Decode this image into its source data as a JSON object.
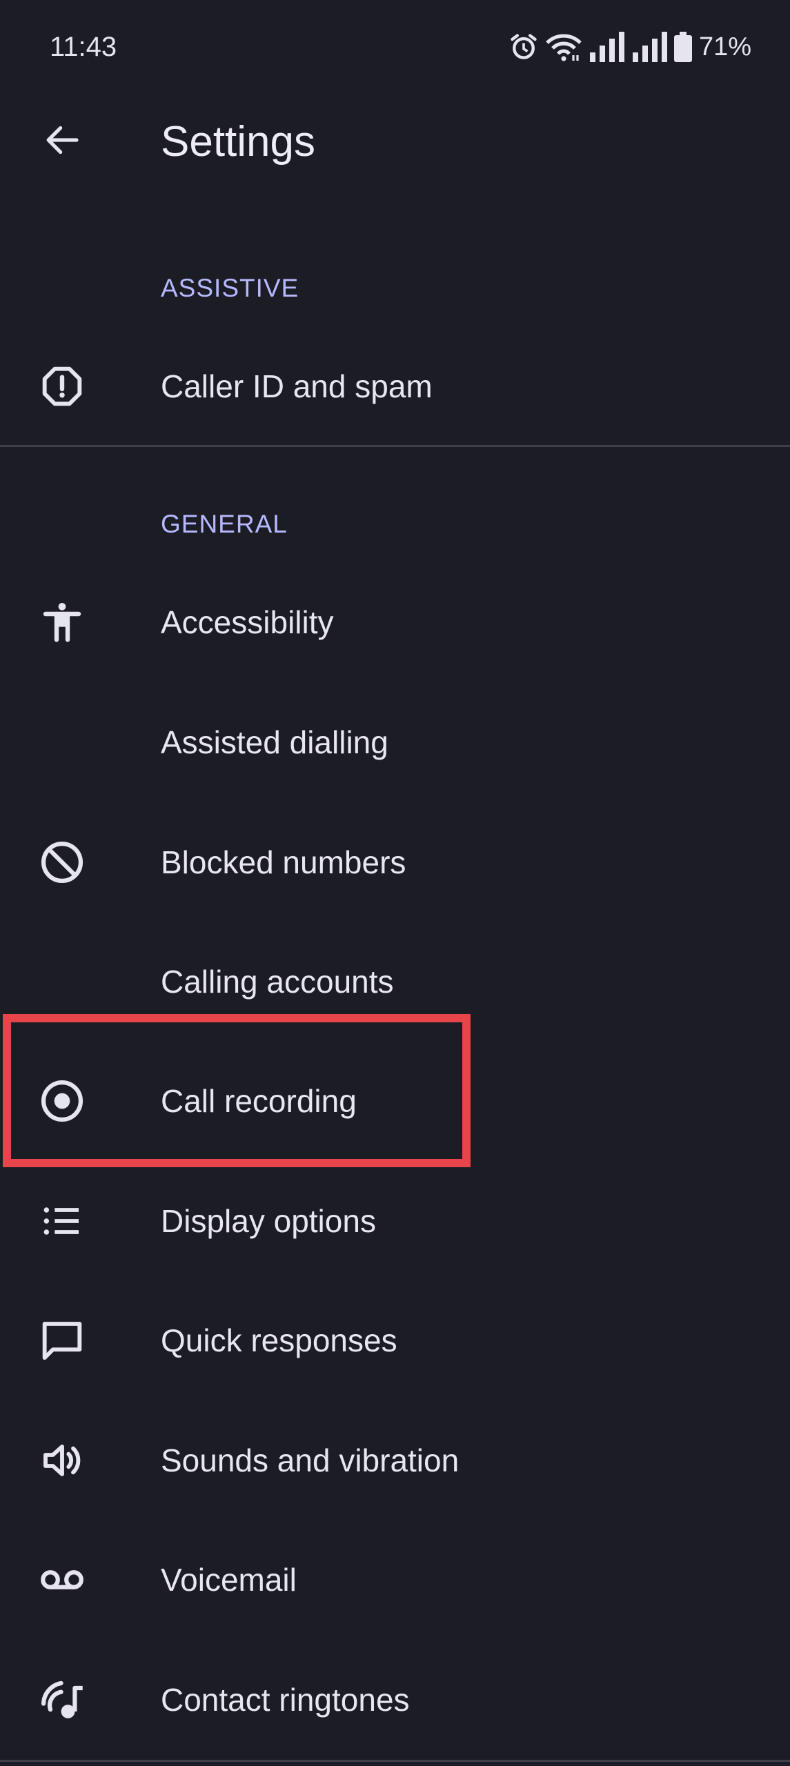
{
  "status_bar": {
    "time": "11:43",
    "battery_percent": "71%",
    "icons": [
      "alarm-icon",
      "wifi-icon",
      "signal-icon",
      "signal-icon",
      "battery-icon"
    ]
  },
  "app_bar": {
    "title": "Settings",
    "back_icon": "arrow-back-icon"
  },
  "sections": {
    "assistive": {
      "header": "ASSISTIVE",
      "items": [
        {
          "label": "Caller ID and spam",
          "icon": "report-octagon-icon"
        }
      ]
    },
    "general": {
      "header": "GENERAL",
      "items": [
        {
          "label": "Accessibility",
          "icon": "accessibility-icon"
        },
        {
          "label": "Assisted dialling",
          "icon": ""
        },
        {
          "label": "Blocked numbers",
          "icon": "block-icon"
        },
        {
          "label": "Calling accounts",
          "icon": ""
        },
        {
          "label": "Call recording",
          "icon": "record-icon"
        },
        {
          "label": "Display options",
          "icon": "list-icon"
        },
        {
          "label": "Quick responses",
          "icon": "chat-bubble-icon"
        },
        {
          "label": "Sounds and vibration",
          "icon": "volume-icon"
        },
        {
          "label": "Voicemail",
          "icon": "voicemail-icon"
        },
        {
          "label": "Contact ringtones",
          "icon": "ringtone-icon"
        }
      ]
    }
  },
  "colors": {
    "background": "#1c1c25",
    "text": "#e8e7f0",
    "section_header": "#b7b9ff",
    "divider": "#3f3f4a",
    "highlight": "#e8454b"
  }
}
